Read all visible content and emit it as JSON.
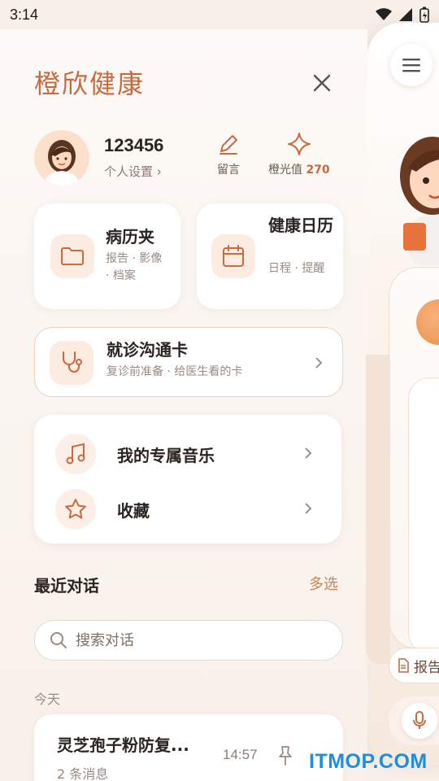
{
  "status_bar": {
    "time": "3:14"
  },
  "app": {
    "title": "橙欣健康"
  },
  "profile": {
    "user_id": "123456",
    "settings_link": "个人设置 ›",
    "actions": [
      {
        "label": "留言",
        "icon": "pencil-icon"
      },
      {
        "label": "橙光值",
        "value": "270",
        "icon": "sparkle-icon"
      }
    ]
  },
  "cards": {
    "records": {
      "title": "病历夹",
      "subtitle": "报告 · 影像 · 档案",
      "icon": "folder-icon"
    },
    "calendar": {
      "title": "健康日历",
      "subtitle": "日程 · 提醒",
      "icon": "calendar-icon"
    },
    "consult": {
      "title": "就诊沟通卡",
      "subtitle": "复诊前准备 · 给医生看的卡",
      "icon": "stethoscope-icon"
    }
  },
  "menu_list": [
    {
      "label": "我的专属音乐",
      "icon": "music-icon"
    },
    {
      "label": "收藏",
      "icon": "star-icon"
    }
  ],
  "recent": {
    "title": "最近对话",
    "multi_select": "多选",
    "search_placeholder": "搜索对话",
    "group_today": "今天",
    "items": [
      {
        "title": "灵芝孢子粉防复...",
        "count": "2 条消息",
        "time": "14:57"
      }
    ]
  },
  "background_app": {
    "report_chip": "报告"
  },
  "watermark": "ITMOP.COM",
  "colors": {
    "accent": "#c86a3e",
    "accent_light": "#fcebe0",
    "bg": "#faf4ef"
  }
}
